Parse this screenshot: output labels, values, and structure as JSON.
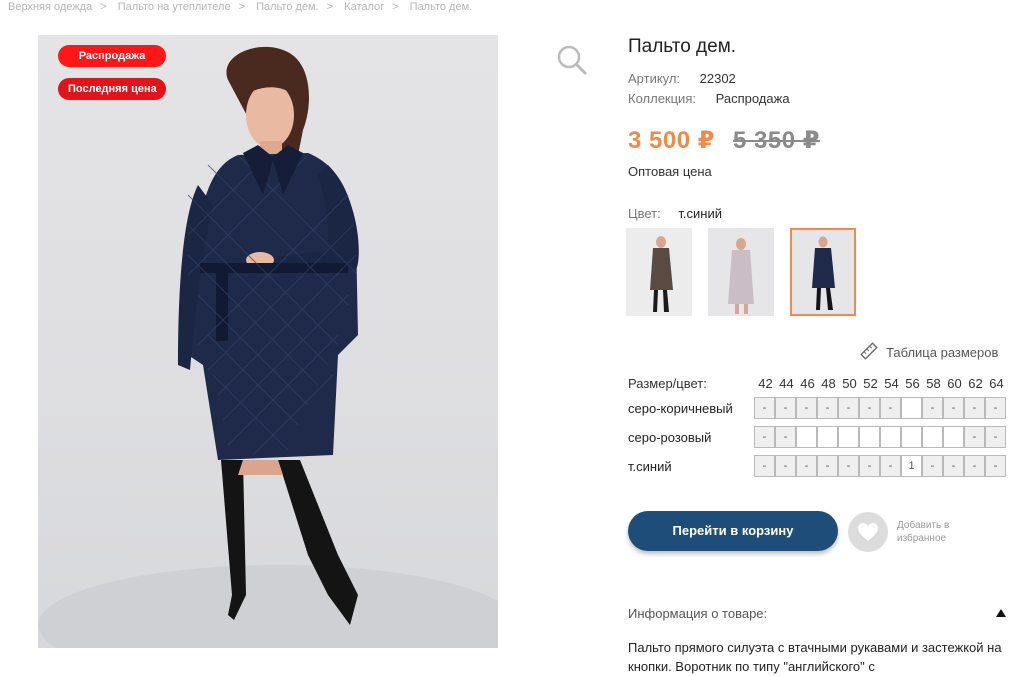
{
  "breadcrumbs": [
    "Верхняя одежда",
    "Пальто на утеплителе",
    "Пальто дем.",
    "Каталог",
    "Пальто дем."
  ],
  "badges": {
    "sale": "Распродажа",
    "last_price": "Последняя цена"
  },
  "product": {
    "title": "Пальто дем.",
    "article_label": "Артикул:",
    "article": "22302",
    "collection_label": "Коллекция:",
    "collection": "Распродажа",
    "price": "3 500 ₽",
    "old_price": "5 350 ₽",
    "price_type": "Оптовая цена",
    "color_label": "Цвет:",
    "color": "т.синий"
  },
  "colors_visual": {
    "accent": "#f08a4b",
    "button": "#1f4d7a",
    "badge": "#ff1717"
  },
  "size_table_link": "Таблица размеров",
  "grid": {
    "header": "Размер/цвет:",
    "sizes": [
      "42",
      "44",
      "46",
      "48",
      "50",
      "52",
      "54",
      "56",
      "58",
      "60",
      "62",
      "64"
    ],
    "rows": [
      {
        "color": "серо-коричневый",
        "cells": [
          "-",
          "-",
          "-",
          "-",
          "-",
          "-",
          "-",
          "",
          "-",
          "-",
          "-",
          "-"
        ]
      },
      {
        "color": "серо-розовый",
        "cells": [
          "-",
          "-",
          "",
          "",
          "",
          "",
          "",
          "",
          "",
          "",
          "-",
          "-"
        ]
      },
      {
        "color": "т.синий",
        "cells": [
          "-",
          "-",
          "-",
          "-",
          "-",
          "-",
          "-",
          "1",
          "-",
          "-",
          "-",
          "-"
        ]
      }
    ]
  },
  "cart_button": "Перейти в корзину",
  "favorite": {
    "line1": "Добавить в",
    "line2": "избранное"
  },
  "info": {
    "heading": "Информация о товаре:",
    "text": "Пальто прямого силуэта с втачными рукавами и застежкой на кнопки. Воротник по типу \"английского\" с"
  }
}
